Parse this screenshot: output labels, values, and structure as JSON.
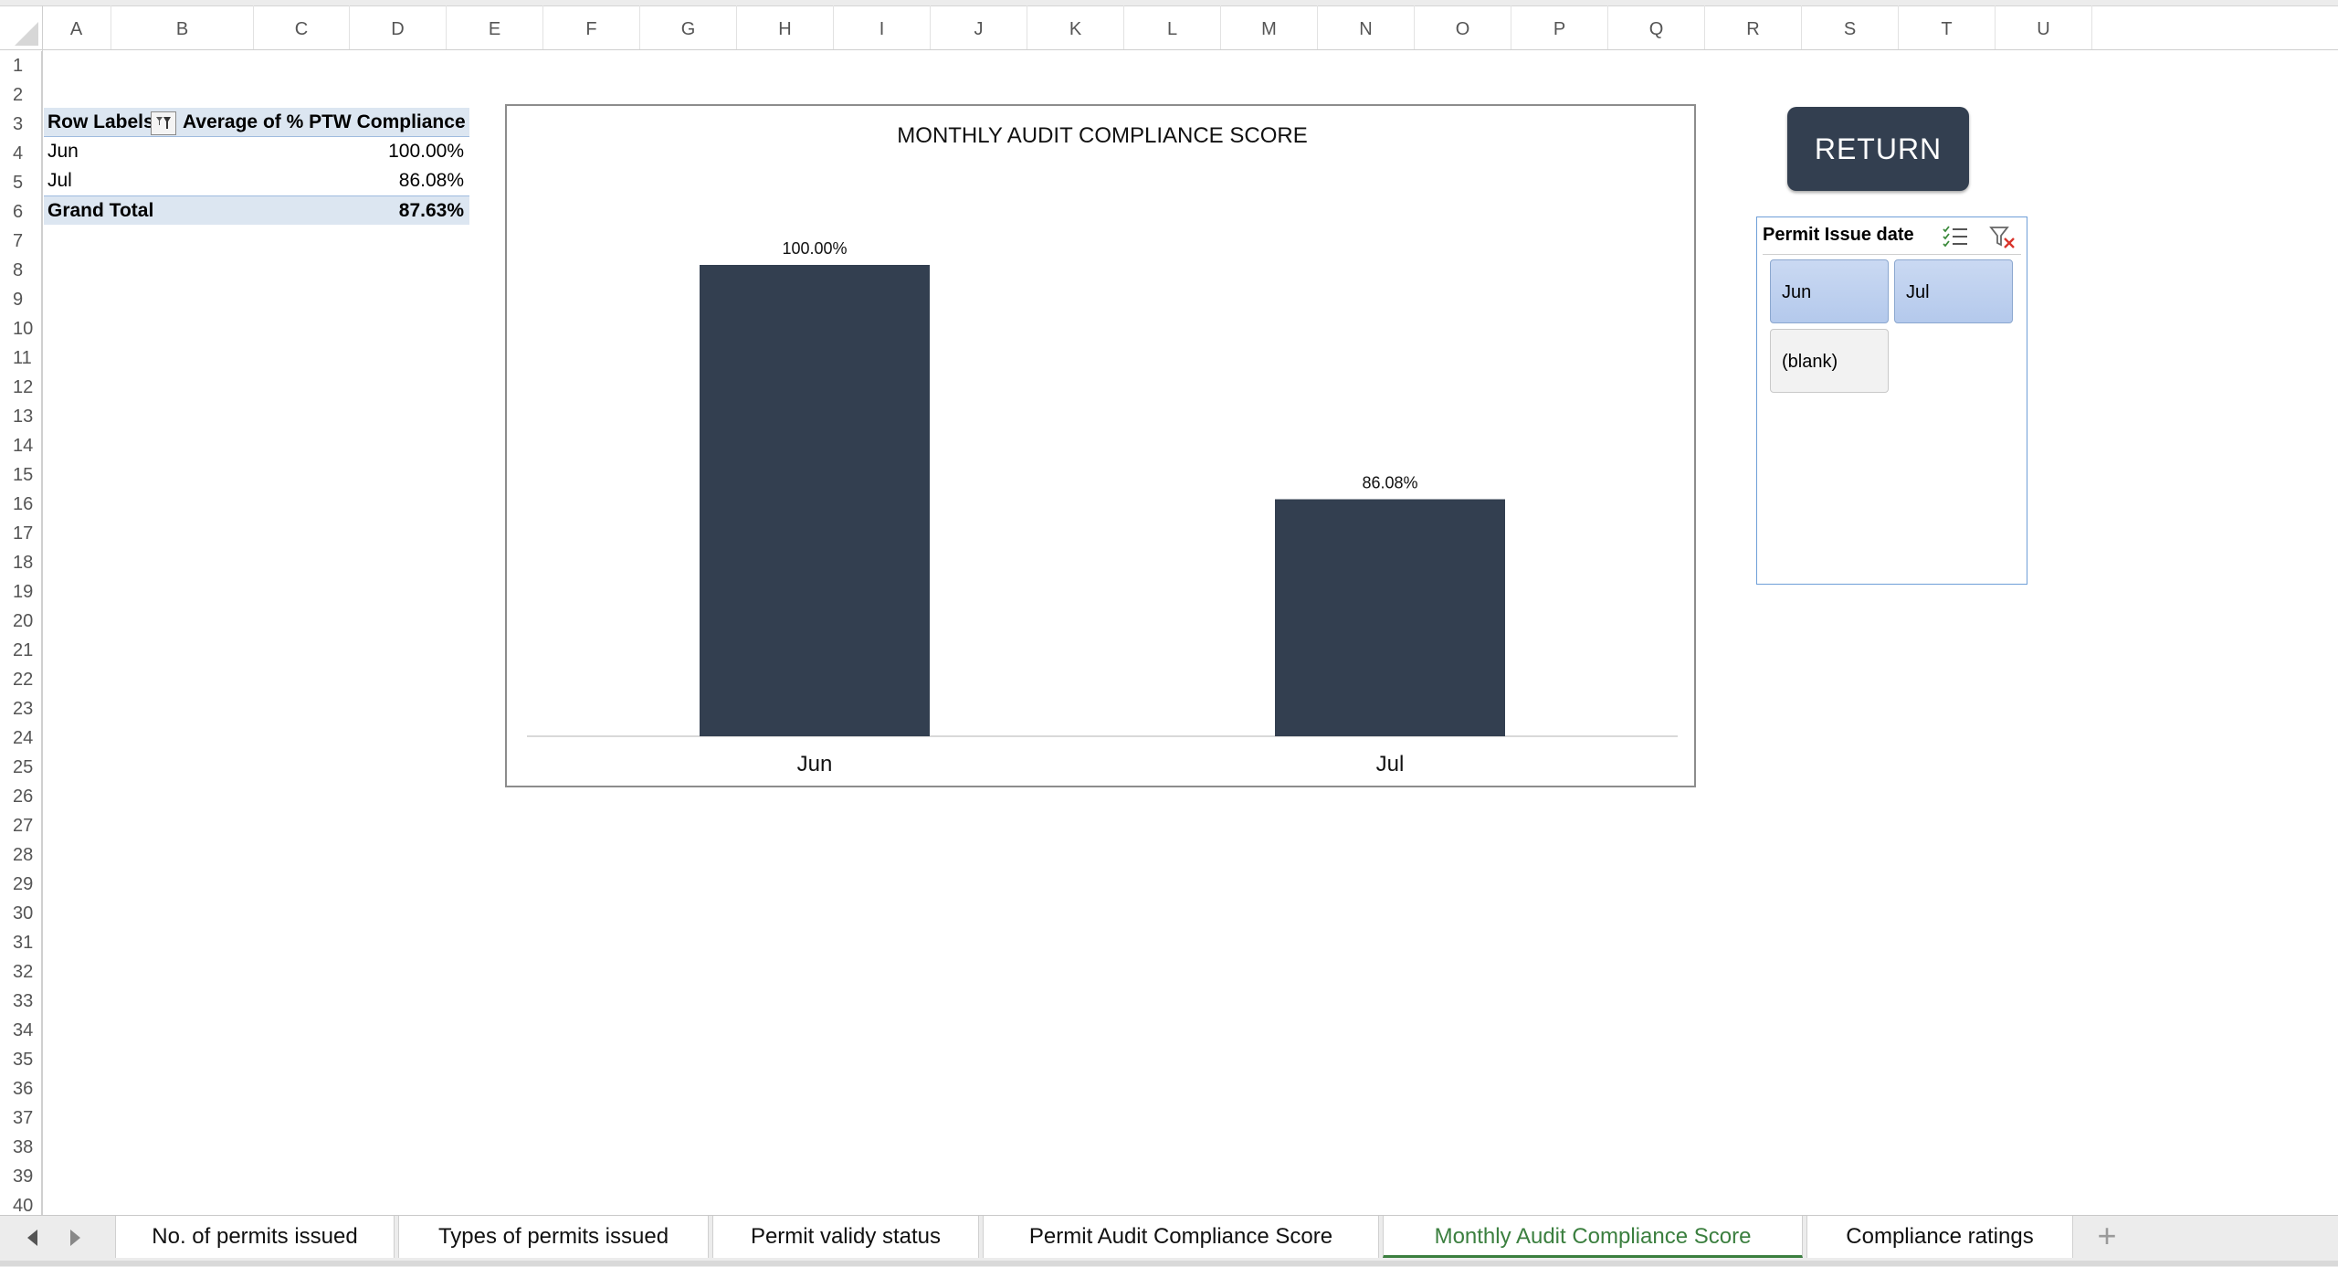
{
  "columns": [
    "A",
    "B",
    "C",
    "D",
    "E",
    "F",
    "G",
    "H",
    "I",
    "J",
    "K",
    "L",
    "M",
    "N",
    "O",
    "P",
    "Q",
    "R",
    "S",
    "T",
    "U"
  ],
  "rows": [
    "1",
    "2",
    "3",
    "4",
    "5",
    "6",
    "7",
    "8",
    "9",
    "10",
    "11",
    "12",
    "13",
    "14",
    "15",
    "16",
    "17",
    "18",
    "19",
    "20",
    "21",
    "22",
    "23",
    "24",
    "25",
    "26",
    "27",
    "28",
    "29",
    "30",
    "31",
    "32",
    "33",
    "34",
    "35",
    "36",
    "37",
    "38",
    "39",
    "40"
  ],
  "pivot": {
    "header_label": "Row Labels",
    "header_value": "Average of % PTW Compliance",
    "rows": [
      {
        "label": "Jun",
        "value": "100.00%"
      },
      {
        "label": "Jul",
        "value": "86.08%"
      }
    ],
    "total_label": "Grand Total",
    "total_value": "87.63%"
  },
  "chart_data": {
    "type": "bar",
    "title": "MONTHLY AUDIT COMPLIANCE SCORE",
    "categories": [
      "Jun",
      "Jul"
    ],
    "values": [
      100.0,
      86.08
    ],
    "data_labels": [
      "100.00%",
      "86.08%"
    ],
    "ylim": [
      72,
      100
    ],
    "bar_color": "#333f50",
    "grid": false,
    "legend": "none"
  },
  "return_button": {
    "label": "RETURN",
    "color": "#333f50"
  },
  "slicer": {
    "title": "Permit Issue date",
    "items": [
      {
        "label": "Jun",
        "selected": true
      },
      {
        "label": "Jul",
        "selected": true
      },
      {
        "label": "(blank)",
        "selected": false
      }
    ],
    "icons": [
      "multi-select-icon",
      "clear-filter-icon"
    ]
  },
  "tabs": [
    {
      "label": "No. of permits issued",
      "active": false
    },
    {
      "label": "Types of permits issued",
      "active": false
    },
    {
      "label": "Permit validy status",
      "active": false
    },
    {
      "label": "Permit Audit Compliance Score",
      "active": false
    },
    {
      "label": "Monthly Audit Compliance Score",
      "active": true
    },
    {
      "label": "Compliance ratings",
      "active": false
    }
  ],
  "colors": {
    "active_tab": "#3b7f3f",
    "pivot_header_bg": "#dce6f1"
  }
}
